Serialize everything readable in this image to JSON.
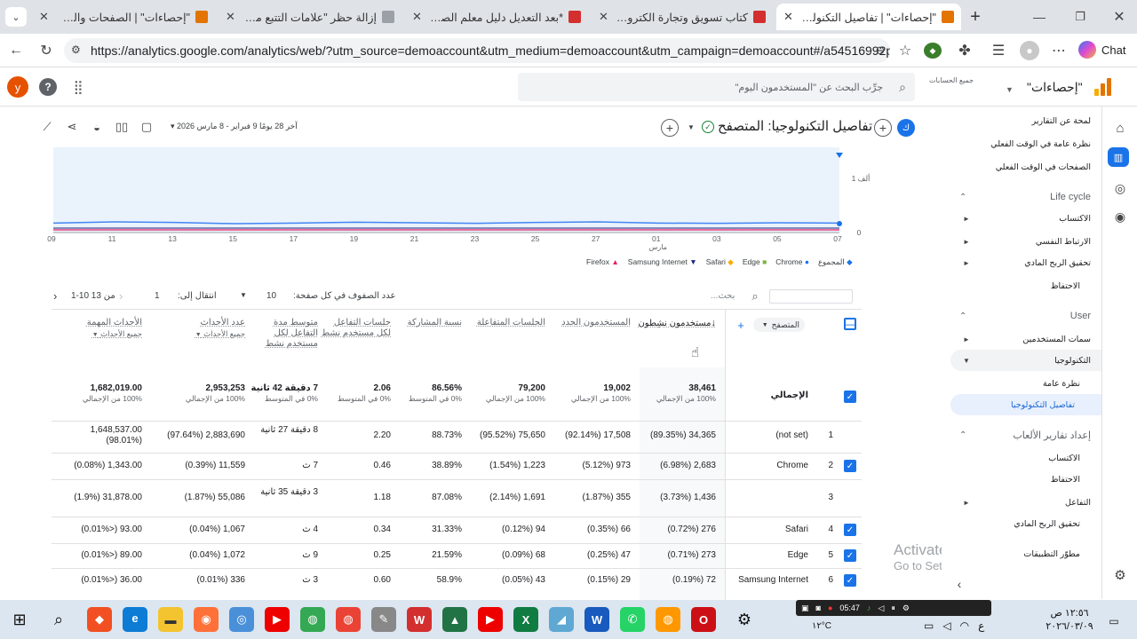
{
  "browser": {
    "tabs": [
      {
        "title": "\"إحصاءات\" | الصفحات والشاشات",
        "active": false
      },
      {
        "title": "إزالة حظر \"علامات التتبع من Google",
        "active": false
      },
      {
        "title": "*بعد التعديل دليل معلم الصف ال",
        "active": false
      },
      {
        "title": "كتاب تسويق وتجارة الكترونية الص",
        "active": false
      },
      {
        "title": "\"إحصاءات\" | تفاصيل التكنولوجيا:",
        "active": true
      }
    ],
    "url": "https://analytics.google.com/analytics/web/?utm_source=demoaccount&utm_medium=demoaccount&utm_campaign=demoaccount#/a54516992p...",
    "chat_label": "Chat",
    "new_tab": "+"
  },
  "ga": {
    "property_name": "\"إحصاءات\"",
    "account_label": "جميع الحسابات",
    "search_placeholder": "جرِّب البحث عن \"المستخدمون اليوم\"",
    "avatar_letter": "y",
    "report_title": "تفاصيل التكنولوجيا: المتصفح",
    "date_compare": "آخر 28 يومًا 9 فبراير - 8 مارس 2026",
    "chart_ylabel": "1 ألف",
    "chart_zero": "0",
    "chart_month": "مارس"
  },
  "chart_data": {
    "type": "line",
    "x": [
      "09",
      "11",
      "13",
      "15",
      "17",
      "19",
      "21",
      "23",
      "25",
      "27",
      "01",
      "03",
      "05",
      "07"
    ],
    "legend": [
      "المجموع",
      "Chrome",
      "Edge",
      "Safari",
      "Samsung Internet",
      "Firefox"
    ],
    "legend_colors": [
      "#1a73e8",
      "#1a73e8",
      "#7cb342",
      "#f9ab00",
      "#1a237e",
      "#e91e63"
    ],
    "ylabels": [
      "1 ألف",
      "0"
    ],
    "series": [
      {
        "name": "المجموع",
        "values": [
          1380,
          1400,
          1390,
          1370,
          1380,
          1395,
          1385,
          1375,
          1390,
          1400,
          1380,
          1375,
          1385,
          1380
        ]
      }
    ]
  },
  "sidebar": {
    "items": [
      {
        "label": "لمحة عن التقارير",
        "type": "link"
      },
      {
        "label": "نظرة عامة في الوقت الفعلي",
        "type": "link"
      },
      {
        "label": "الصفحات في الوقت الفعلي",
        "type": "link"
      },
      {
        "label": "Life cycle",
        "type": "section"
      },
      {
        "label": "الاكتساب",
        "type": "group"
      },
      {
        "label": "الارتباط النفسي",
        "type": "group"
      },
      {
        "label": "تحقيق الربح المادي",
        "type": "group"
      },
      {
        "label": "الاحتفاظ",
        "type": "link"
      },
      {
        "label": "User",
        "type": "section"
      },
      {
        "label": "سمات المستخدمين",
        "type": "group"
      },
      {
        "label": "التكنولوجيا",
        "type": "group-open"
      },
      {
        "label": "نظرة عامة",
        "type": "link"
      },
      {
        "label": "تفاصيل التكنولوجيا",
        "type": "selected"
      },
      {
        "label": "إعداد تقارير الألعاب",
        "type": "section"
      },
      {
        "label": "الاكتساب",
        "type": "link"
      },
      {
        "label": "الاحتفاظ",
        "type": "link"
      },
      {
        "label": "التفاعل",
        "type": "group"
      },
      {
        "label": "تحقيق الربح المادي",
        "type": "link"
      },
      {
        "label": "مطوّر التطبيقات",
        "type": "link"
      }
    ]
  },
  "table": {
    "search_placeholder": "بحث...",
    "rows_per_page_label": "عدد الصفوف في كل صفحة:",
    "rows_per_page": "10",
    "goto_label": "انتقال إلى:",
    "goto_value": "1",
    "range": "1-10 من 13",
    "dimension": "المتصفح",
    "columns": [
      {
        "label": "مستخدمون نشِطون",
        "sorted": true
      },
      {
        "label": "المستخدمون الجدد"
      },
      {
        "label": "الجلسات المتفاعلة"
      },
      {
        "label": "نسبة المشاركة"
      },
      {
        "label": "جلسات التفاعل لكل مستخدم نشط"
      },
      {
        "label": "متوسط مدة التفاعل لكل مستخدم نشط"
      },
      {
        "label": "عدد الأحداث",
        "sub": "جميع الأحداث"
      },
      {
        "label": "الأحداث المهمة",
        "sub": "جميع الأحداث"
      }
    ],
    "total": {
      "label": "الإجمالي",
      "values": [
        "38,461",
        "19,002",
        "79,200",
        "86.56%",
        "2.06",
        "7 دقيقة 42 ثانية",
        "2,953,253",
        "1,682,019.00"
      ],
      "subs": [
        "100% من الإجمالي",
        "100% من الإجمالي",
        "100% من الإجمالي",
        "0% في المتوسط",
        "0% في المتوسط",
        "0% في المتوسط",
        "100% من الإجمالي",
        "100% من الإجمالي"
      ]
    },
    "rows": [
      {
        "n": "1",
        "name": "(not set)",
        "checked": false,
        "values": [
          "34,365",
          "17,508",
          "75,650",
          "88.73%",
          "2.20",
          "8 دقيقة 27 ثانية",
          "2,883,690",
          "1,648,537.00"
        ],
        "pcts": [
          "(89.35%)",
          "(92.14%)",
          "(95.52%)",
          "",
          "",
          "",
          "(97.64%)",
          "(98.01%)"
        ]
      },
      {
        "n": "2",
        "name": "Chrome",
        "checked": true,
        "values": [
          "2,683",
          "973",
          "1,223",
          "38.89%",
          "0.46",
          "7 ث",
          "11,559",
          "1,343.00"
        ],
        "pcts": [
          "(6.98%)",
          "(5.12%)",
          "(1.54%)",
          "",
          "",
          "",
          "(0.39%)",
          "(0.08%)"
        ]
      },
      {
        "n": "3",
        "name": "",
        "checked": false,
        "values": [
          "1,436",
          "355",
          "1,691",
          "87.08%",
          "1.18",
          "3 دقيقة 35 ثانية",
          "55,086",
          "31,878.00"
        ],
        "pcts": [
          "(3.73%)",
          "(1.87%)",
          "(2.14%)",
          "",
          "",
          "",
          "(1.87%)",
          "(1.9%)"
        ]
      },
      {
        "n": "4",
        "name": "Safari",
        "checked": true,
        "values": [
          "276",
          "66",
          "94",
          "31.33%",
          "0.34",
          "4 ث",
          "1,067",
          "93.00"
        ],
        "pcts": [
          "(0.72%)",
          "(0.35%)",
          "(0.12%)",
          "",
          "",
          "",
          "(0.04%)",
          "(<0.01%)"
        ]
      },
      {
        "n": "5",
        "name": "Edge",
        "checked": true,
        "values": [
          "273",
          "47",
          "68",
          "21.59%",
          "0.25",
          "9 ث",
          "1,072",
          "89.00"
        ],
        "pcts": [
          "(0.71%)",
          "(0.25%)",
          "(0.09%)",
          "",
          "",
          "",
          "(0.04%)",
          "(<0.01%)"
        ]
      },
      {
        "n": "6",
        "name": "Samsung Internet",
        "checked": true,
        "values": [
          "72",
          "29",
          "43",
          "58.9%",
          "0.60",
          "3 ث",
          "336",
          "36.00"
        ],
        "pcts": [
          "(0.19%)",
          "(0.15%)",
          "(0.05%)",
          "",
          "",
          "",
          "(0.01%)",
          "(<0.01%)"
        ]
      }
    ]
  },
  "watermark": {
    "title": "Activate Windows",
    "sub": "Go to Settings to activate Windows."
  },
  "taskbar": {
    "time": "١٢:٥٦ ص",
    "date": "٢٠٢٦/٠٣/٠٩",
    "temp": "١٢°C",
    "rec_time": "05:47"
  }
}
